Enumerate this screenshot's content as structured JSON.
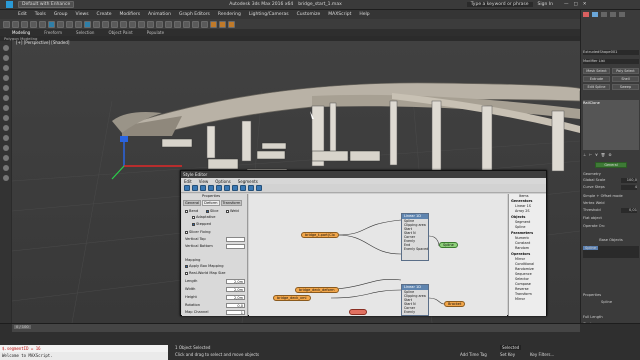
{
  "window": {
    "title": "bridge_start_1.max",
    "autodesk_label": "Autodesk 3ds Max 2016 x64",
    "workspace": "Default with Enhance",
    "search_hint": "Type a keyword or phrase",
    "user": "Sign In"
  },
  "menu": [
    "Edit",
    "Tools",
    "Group",
    "Views",
    "Create",
    "Modifiers",
    "Animation",
    "Graph Editors",
    "Rendering",
    "Lighting/Cameras",
    "Customize",
    "MAXScript",
    "Help"
  ],
  "ribbon_tabs": [
    "Modeling",
    "Freeform",
    "Selection",
    "Object Paint",
    "Populate"
  ],
  "ribbon_sub": "Polygon Modeling",
  "viewport": {
    "label": "[+] [Perspective] [Shaded]"
  },
  "command_panel": {
    "object_name": "ExtrudedShape001",
    "modifier_list": "Modifier List",
    "buttons": [
      "Mesh Select",
      "Poly Select",
      "Extrude",
      "Shell",
      "Edit Spline",
      "Sweep"
    ],
    "stack_item": "RailClone",
    "section_title": "General",
    "geometry_label": "Geometry",
    "global_scale_label": "Global Scale",
    "global_scale_value": "100,0",
    "curve_steps_label": "Curve Steps",
    "curve_steps_value": "4",
    "simple_offset": "Simple + Offset mode",
    "vertex_weld": "Vertex Weld",
    "threshold_label": "Threshold",
    "threshold_value": "0,01",
    "flat_label": "Flat object",
    "operate_on": "Operate On:",
    "base_objects": "Base Objects",
    "spline_item": "Spline",
    "properties": "Properties",
    "spline_prop": "Spline",
    "full_length": "Full Length",
    "start_label": "Start"
  },
  "style_editor": {
    "title": "Style Editor",
    "menu": [
      "Edit",
      "View",
      "Options",
      "Segments"
    ],
    "properties_header": "Properties",
    "tabs": [
      "General",
      "Deform",
      "Transform"
    ],
    "active_tab": "Deform",
    "props": {
      "bend": "Bend",
      "slice": "Slice",
      "weld": "Weld",
      "adaptative": "Adaptative",
      "stepped": "Stepped",
      "slicer_fixing": "Slicer Fixing",
      "vertical_top": "Vertical Top",
      "vertical_bottom": "Vertical Bottom",
      "mapping": "Mapping",
      "apply_box_mapping": "Apply Box Mapping",
      "real_world_map_size": "Real-World Map Size",
      "length": "Length",
      "length_value": "2,0m",
      "width": "Width",
      "width_value": "2,0m",
      "height": "Height",
      "height_value": "2,0m",
      "rotation": "Rotation",
      "rotation_value": "0,0",
      "map_channel": "Map Channel",
      "map_channel_value": "1"
    },
    "nodes": {
      "linear_top": {
        "title": "Linear 1D",
        "items": [
          "Spline",
          "Clipping area",
          "Start",
          "Start N",
          "Corner",
          "Evenly",
          "End",
          "Evenly Spaced"
        ]
      },
      "linear_bottom": {
        "title": "Linear 1D",
        "items": [
          "Spline",
          "Clipping area",
          "Start",
          "Start N",
          "Corner",
          "Evenly",
          "End"
        ]
      },
      "segment_a": "bridge_t-part(Clo",
      "segment_b": "bridge_deck_deform",
      "segment_c": "bridge_deck_xml",
      "spline_out": "Spline",
      "bracket": "Bracket"
    },
    "items_header": "Items",
    "list": {
      "generators": "Generators",
      "gen_items": [
        "Linear 1S",
        "Array 2S"
      ],
      "objects": "Objects",
      "obj_items": [
        "Segment",
        "Spline"
      ],
      "parameters": "Parameters",
      "par_items": [
        "Numeric",
        "Constant",
        "Random"
      ],
      "operators": "Operators",
      "op_items": [
        "Mirror",
        "Conditional",
        "Randomize",
        "Sequence",
        "Selector",
        "Compose",
        "Reverse",
        "Transform",
        "Mirror"
      ]
    }
  },
  "timeline": {
    "range": "0 / 100",
    "objects_selected": "1 Object Selected",
    "hint": "Click and drag to select and move objects",
    "add_time_tag": "Add Time Tag",
    "selected": "Selected",
    "set_key": "Set Key",
    "key_filters": "Key Filters..."
  },
  "maxscript": {
    "line1": "$.segmentID = 16",
    "line2": "Welcome to MAXScript."
  }
}
